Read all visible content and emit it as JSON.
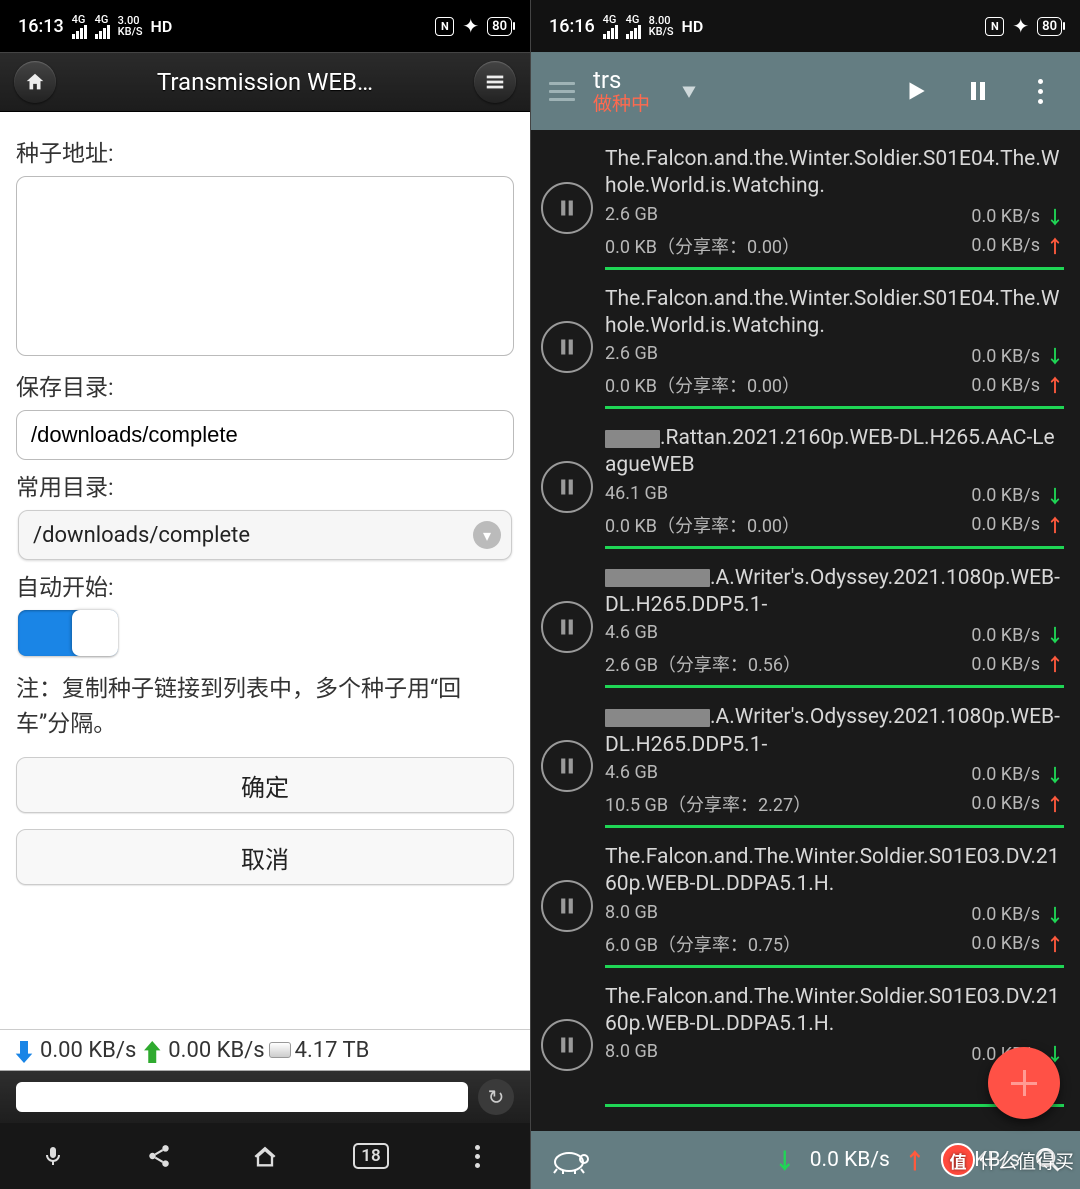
{
  "left": {
    "status": {
      "time": "16:13",
      "sig1": "4G",
      "sig2": "4G",
      "speed": "3.00",
      "speed_unit": "KB/S",
      "hd": "HD",
      "battery": "80"
    },
    "header": {
      "title": "Transmission WEB…"
    },
    "form": {
      "seed_url_label": "种子地址:",
      "seed_url_value": "",
      "save_dir_label": "保存目录:",
      "save_dir_value": "/downloads/complete",
      "common_dir_label": "常用目录:",
      "common_dir_value": "/downloads/complete",
      "auto_start_label": "自动开始:",
      "note_prefix": "注：",
      "note_text": "复制种子链接到列表中，多个种子用“回车”分隔。",
      "ok": "确定",
      "cancel": "取消"
    },
    "speed": {
      "down": "0.00 KB/s",
      "up": "0.00 KB/s",
      "disk": "4.17 TB"
    },
    "nav": {
      "tabs": "18"
    }
  },
  "right": {
    "status": {
      "time": "16:16",
      "sig1": "4G",
      "sig2": "4G",
      "speed": "8.00",
      "speed_unit": "KB/S",
      "hd": "HD",
      "battery": "80"
    },
    "header": {
      "title": "trs",
      "subtitle": "做种中"
    },
    "torrents": [
      {
        "name": "The.Falcon.and.the.Winter.Soldier.S01E04.The.Whole.World.is.Watching.",
        "redact": 0,
        "size": "2.6 GB",
        "down": "0.0 KB/s",
        "uploaded": "0.0 KB（分享率：0.00）",
        "up": "0.0 KB/s",
        "progress": 100
      },
      {
        "name": "The.Falcon.and.the.Winter.Soldier.S01E04.The.Whole.World.is.Watching.",
        "redact": 0,
        "size": "2.6 GB",
        "down": "0.0 KB/s",
        "uploaded": "0.0 KB（分享率：0.00）",
        "up": "0.0 KB/s",
        "progress": 100
      },
      {
        "name": ".Rattan.2021.2160p.WEB-DL.H265.AAC-LeagueWEB",
        "redact": 55,
        "size": "46.1 GB",
        "down": "0.0 KB/s",
        "uploaded": "0.0 KB（分享率：0.00）",
        "up": "0.0 KB/s",
        "progress": 100
      },
      {
        "name": ".A.Writer's.Odyssey.2021.1080p.WEB-DL.H265.DDP5.1-",
        "redact": 105,
        "size": "4.6 GB",
        "down": "0.0 KB/s",
        "uploaded": "2.6 GB（分享率：0.56）",
        "up": "0.0 KB/s",
        "progress": 100
      },
      {
        "name": ".A.Writer's.Odyssey.2021.1080p.WEB-DL.H265.DDP5.1-",
        "redact": 105,
        "size": "4.6 GB",
        "down": "0.0 KB/s",
        "uploaded": "10.5 GB（分享率：2.27）",
        "up": "0.0 KB/s",
        "progress": 100
      },
      {
        "name": "The.Falcon.and.The.Winter.Soldier.S01E03.DV.2160p.WEB-DL.DDPA5.1.H.",
        "redact": 0,
        "size": "8.0 GB",
        "down": "0.0 KB/s",
        "uploaded": "6.0 GB（分享率：0.75）",
        "up": "0.0 KB/s",
        "progress": 100
      },
      {
        "name": "The.Falcon.and.The.Winter.Soldier.S01E03.DV.2160p.WEB-DL.DDPA5.1.H.",
        "redact": 0,
        "size": "8.0 GB",
        "down": "0.0 KB/s",
        "uploaded": "",
        "up": "",
        "progress": 100
      }
    ],
    "footer": {
      "down": "0.0 KB/s",
      "up": "0.0 KB/s"
    },
    "watermark": "什么值得买"
  }
}
